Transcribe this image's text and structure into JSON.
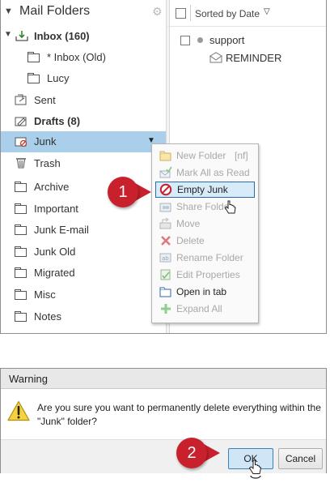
{
  "folders": {
    "header_title": "Mail Folders",
    "items": [
      {
        "label": "Inbox (160)"
      },
      {
        "label": "* Inbox (Old)"
      },
      {
        "label": "Lucy"
      },
      {
        "label": "Sent"
      },
      {
        "label": "Drafts (8)"
      },
      {
        "label": "Junk"
      },
      {
        "label": "Trash"
      },
      {
        "label": "Archive"
      },
      {
        "label": "Important"
      },
      {
        "label": "Junk E-mail"
      },
      {
        "label": "Junk Old"
      },
      {
        "label": "Migrated"
      },
      {
        "label": "Misc"
      },
      {
        "label": "Notes"
      }
    ]
  },
  "message_list": {
    "sort_label": "Sorted by Date",
    "sender": "support",
    "subject": "REMINDER"
  },
  "context_menu": {
    "items": [
      {
        "label": "New Folder",
        "shortcut": "[nf]"
      },
      {
        "label": "Mark All as Read"
      },
      {
        "label": "Empty Junk"
      },
      {
        "label": "Share Folder"
      },
      {
        "label": "Move"
      },
      {
        "label": "Delete"
      },
      {
        "label": "Rename Folder"
      },
      {
        "label": "Edit Properties"
      },
      {
        "label": "Open in tab"
      },
      {
        "label": "Expand All"
      }
    ]
  },
  "callouts": {
    "step1": "1",
    "step2": "2"
  },
  "dialog": {
    "title": "Warning",
    "message": "Are you sure you want to permanently delete everything within the \"Junk\" folder?",
    "ok_label": "OK",
    "cancel_label": "Cancel"
  },
  "colors": {
    "selection": "#a9cfeb",
    "menu_highlight_border": "#2c6aa8",
    "callout_red": "#c8202d"
  }
}
